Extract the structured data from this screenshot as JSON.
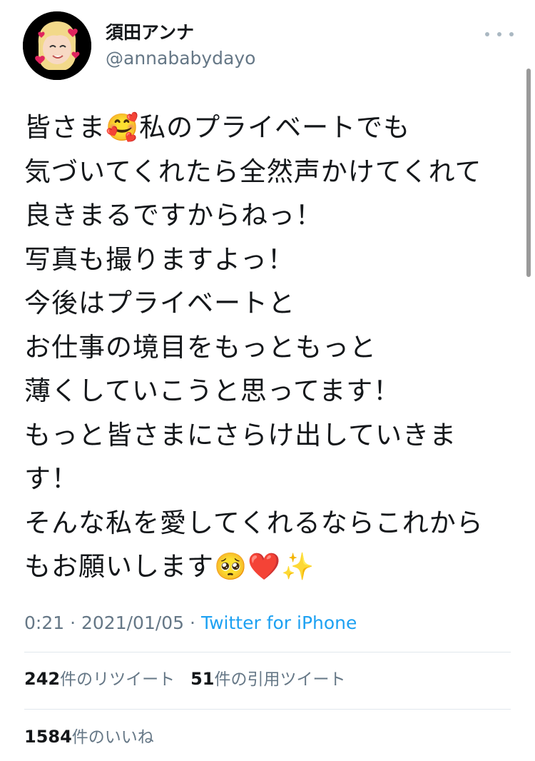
{
  "author": {
    "display_name": "須田アンナ",
    "handle": "@annababydayo"
  },
  "tweet": {
    "lines": [
      "皆さま🥰私のプライベートでも",
      "気づいてくれたら全然声かけてくれて",
      "良きまるですからねっ！",
      "写真も撮りますよっ！",
      "今後はプライベートと",
      "お仕事の境目をもっともっと",
      "薄くしていこうと思ってます！",
      "もっと皆さまにさらけ出していきま",
      "す！",
      "そんな私を愛してくれるならこれから",
      "もお願いします🥺❤️✨"
    ],
    "time": "0:21",
    "date": "2021/01/05",
    "separator": "·",
    "source": "Twitter for iPhone"
  },
  "stats": {
    "retweets_count": "242",
    "retweets_label": "件のリツイート",
    "quotes_count": "51",
    "quotes_label": "件の引用ツイート",
    "likes_count": "1584",
    "likes_label": "件のいいね"
  },
  "icons": {
    "more": "more-horizontal-icon"
  },
  "colors": {
    "link": "#1da1f2",
    "secondary_text": "#657786",
    "divider": "#e1e8ed"
  }
}
